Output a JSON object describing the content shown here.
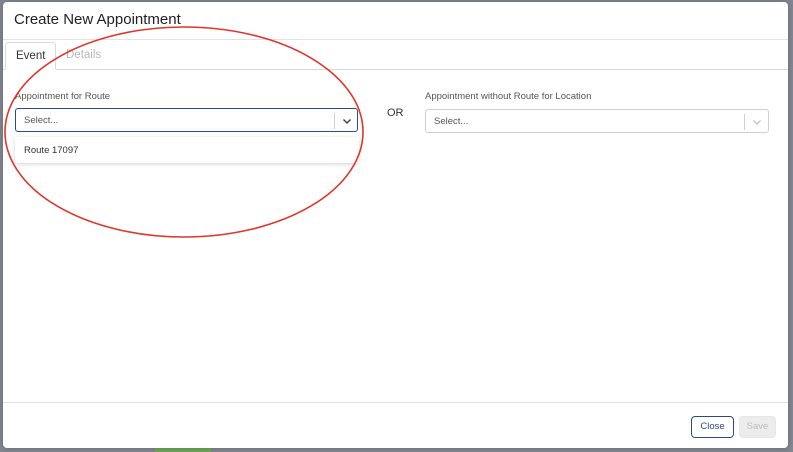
{
  "dialog": {
    "title": "Create New Appointment",
    "tabs": [
      {
        "label": "Event",
        "active": true
      },
      {
        "label": "Details",
        "active": false
      }
    ]
  },
  "route_field": {
    "label": "Appointment for Route",
    "placeholder": "Select...",
    "options": [
      "Route 17097"
    ]
  },
  "separator_text": "OR",
  "location_field": {
    "label": "Appointment without Route for Location",
    "placeholder": "Select..."
  },
  "footer": {
    "close_label": "Close",
    "save_label": "Save"
  },
  "colors": {
    "accent": "#2c4a8a",
    "annotation": "#e0352b"
  },
  "icons": {
    "dropdown": "chevron-down-icon"
  }
}
